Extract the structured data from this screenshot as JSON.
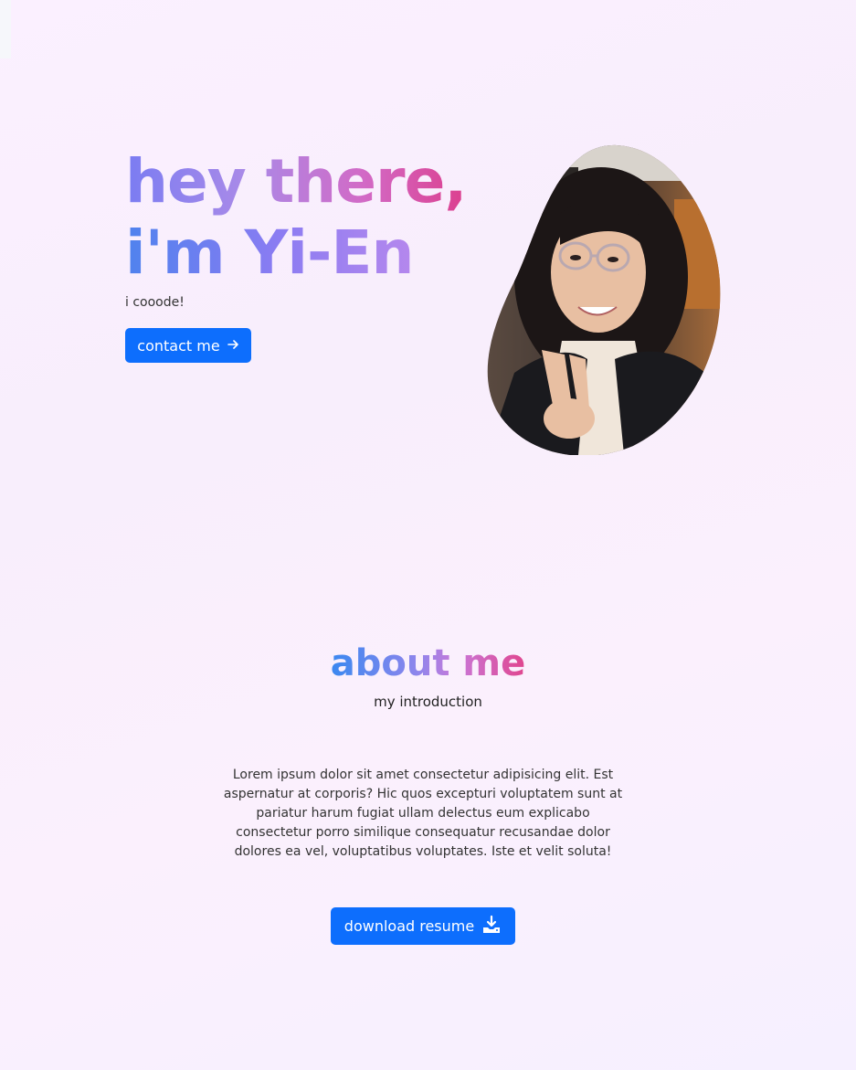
{
  "hero": {
    "greeting_line1": "hey there,",
    "greeting_line2": "i'm Yi-En",
    "tagline": "i cooode!",
    "contact_label": "contact me",
    "contact_icon": "arrow-right-icon",
    "portrait_icon": "portrait-photo"
  },
  "about": {
    "title": "about me",
    "subtitle": "my introduction",
    "body": "Lorem ipsum dolor sit amet consectetur adipisicing elit. Est aspernatur at corporis? Hic quos excepturi voluptatem sunt at pariatur harum fugiat ullam delectus eum explicabo consectetur porro similique consequatur recusandae dolor dolores ea vel, voluptatibus voluptates. Iste et velit soluta!",
    "resume_label": "download resume",
    "resume_icon": "download-icon"
  },
  "colors": {
    "accent_blue": "#0d6efd",
    "gradient_blue": "#4f82ee",
    "gradient_violet": "#a98ae8",
    "gradient_pink": "#dc3f8e",
    "background": "#f9effd"
  }
}
